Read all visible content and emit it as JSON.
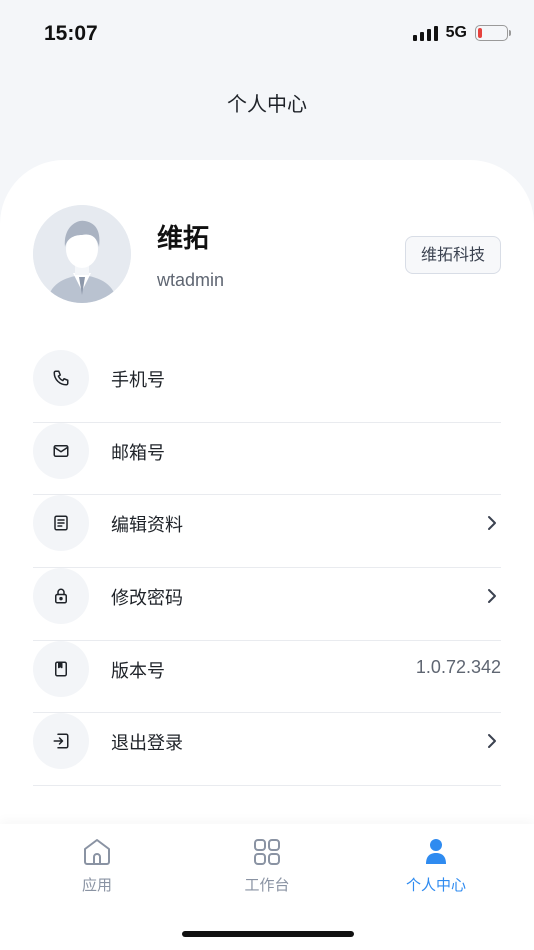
{
  "status_bar": {
    "time": "15:07",
    "network": "5G",
    "battery_level": 0.15,
    "battery_color": "#e5413d"
  },
  "header": {
    "title": "个人中心"
  },
  "profile": {
    "name": "维拓",
    "account": "wtadmin",
    "organization": "维拓科技"
  },
  "menu": {
    "items": [
      {
        "label": "手机号",
        "icon": "phone-icon",
        "has_chevron": false
      },
      {
        "label": "邮箱号",
        "icon": "mail-icon",
        "has_chevron": false
      },
      {
        "label": "编辑资料",
        "icon": "document-icon",
        "has_chevron": true
      },
      {
        "label": "修改密码",
        "icon": "lock-icon",
        "has_chevron": true
      },
      {
        "label": "版本号",
        "icon": "book-icon",
        "value": "1.0.72.342",
        "has_chevron": false
      },
      {
        "label": "退出登录",
        "icon": "logout-icon",
        "has_chevron": true
      }
    ]
  },
  "tabs": {
    "items": [
      {
        "label": "应用",
        "icon": "home-icon",
        "active": false
      },
      {
        "label": "工作台",
        "icon": "grid-icon",
        "active": false
      },
      {
        "label": "个人中心",
        "icon": "person-icon",
        "active": true
      }
    ],
    "active_color": "#2f8bf0",
    "inactive_color": "#8a93a3"
  }
}
